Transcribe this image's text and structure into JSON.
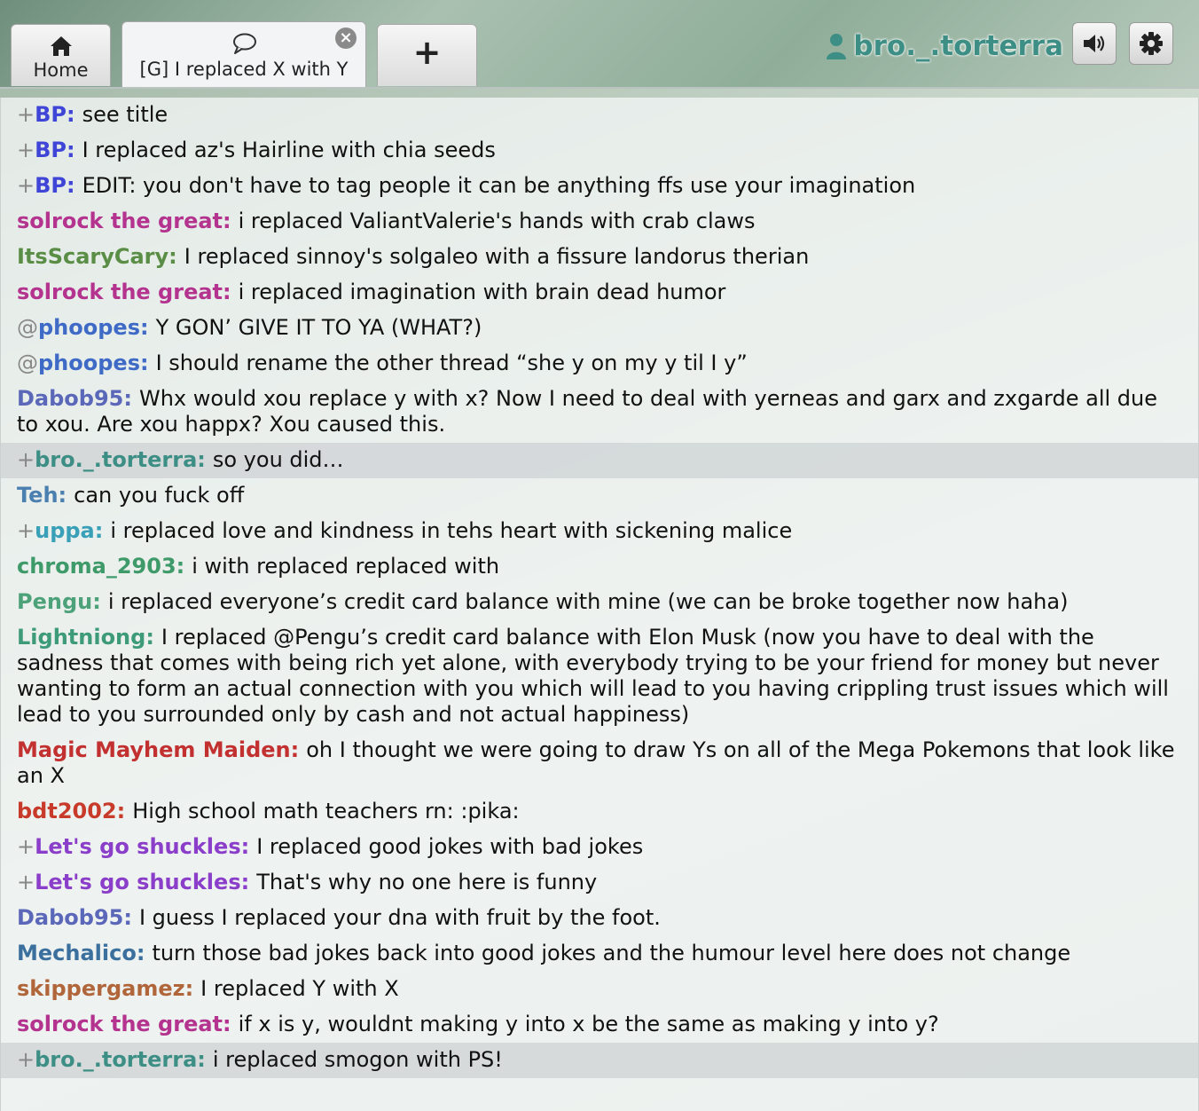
{
  "tabs": {
    "home_label": "Home",
    "room_label": "[G] I replaced X with Y",
    "close_glyph": "×",
    "new_glyph": "+"
  },
  "user": {
    "name": "bro._.torterra"
  },
  "messages": [
    {
      "rank": "+",
      "name": "BP:",
      "color": "#3f45d6",
      "text": "see title"
    },
    {
      "rank": "+",
      "name": "BP:",
      "color": "#3f45d6",
      "text": "I replaced az's Hairline with chia seeds"
    },
    {
      "rank": "+",
      "name": "BP:",
      "color": "#3f45d6",
      "text": "EDIT: you don't have to tag people it can be anything ffs use your imagination"
    },
    {
      "rank": "",
      "name": "solrock the great:",
      "color": "#b3338f",
      "text": "i replaced ValiantValerie's hands with crab claws"
    },
    {
      "rank": "",
      "name": "ItsScaryCary:",
      "color": "#5a8d45",
      "text": "I replaced sinnoy's solgaleo with a fissure landorus therian"
    },
    {
      "rank": "",
      "name": "solrock the great:",
      "color": "#b3338f",
      "text": "i replaced imagination with brain dead humor"
    },
    {
      "rank": "@",
      "name": "phoopes:",
      "color": "#3f6bc7",
      "text": "Y GON’ GIVE IT TO YA (WHAT?)"
    },
    {
      "rank": "@",
      "name": "phoopes:",
      "color": "#3f6bc7",
      "text": "I should rename the other thread “she y on my y til I y”"
    },
    {
      "rank": "",
      "name": "Dabob95:",
      "color": "#5b67b8",
      "text": "Whx would xou replace y with x? Now I need to deal with yerneas and garx and zxgarde all due to xou. Are xou happx? Xou caused this."
    },
    {
      "rank": "+",
      "name": "bro._.torterra:",
      "color": "#3d8f86",
      "text": "so you did…",
      "highlight": true
    },
    {
      "rank": "",
      "name": "Teh:",
      "color": "#4a7fb0",
      "text": "can you fuck off"
    },
    {
      "rank": "+",
      "name": "uppa:",
      "color": "#3aa0b8",
      "text": "i replaced love and kindness in tehs heart with sickening malice"
    },
    {
      "rank": "",
      "name": "chroma_2903:",
      "color": "#3f9a6a",
      "text": "i with replaced replaced with"
    },
    {
      "rank": "",
      "name": "Pengu:",
      "color": "#4ea27a",
      "text": "i replaced everyone’s credit card balance with mine (we can be broke together now haha)"
    },
    {
      "rank": "",
      "name": "Lightniong:",
      "color": "#3e9b7a",
      "text": "I replaced @Pengu’s credit card balance with Elon Musk (now you have to deal with the sadness that comes with being rich yet alone, with everybody trying to be your friend for money but never wanting to form an actual connection with you which will lead to you having crippling trust issues which will lead to you surrounded only by cash and not actual happiness)"
    },
    {
      "rank": "",
      "name": "Magic Mayhem Maiden:",
      "color": "#c23030",
      "text": "oh I thought we were going to draw Ys on all of the Mega Pokemons that look like an X"
    },
    {
      "rank": "",
      "name": "bdt2002:",
      "color": "#c83a2a",
      "text": "High school math teachers rn: :pika:"
    },
    {
      "rank": "+",
      "name": "Let's go shuckles:",
      "color": "#8a3ec9",
      "text": "I replaced good jokes with bad jokes"
    },
    {
      "rank": "+",
      "name": "Let's go shuckles:",
      "color": "#8a3ec9",
      "text": "That's why no one here is funny"
    },
    {
      "rank": "",
      "name": "Dabob95:",
      "color": "#5b67b8",
      "text": "I guess I replaced your dna with fruit by the foot."
    },
    {
      "rank": "",
      "name": "Mechalico:",
      "color": "#3a6f9e",
      "text": "turn those bad jokes back into good jokes and the humour level here does not change"
    },
    {
      "rank": "",
      "name": "skippergamez:",
      "color": "#b0663a",
      "text": "I replaced Y with X"
    },
    {
      "rank": "",
      "name": "solrock the great:",
      "color": "#b3338f",
      "text": "if x is y, wouldnt making y into x be the same as making y into y?"
    },
    {
      "rank": "+",
      "name": "bro._.torterra:",
      "color": "#3d8f86",
      "text": "i replaced smogon with PS!",
      "highlight": true
    }
  ]
}
